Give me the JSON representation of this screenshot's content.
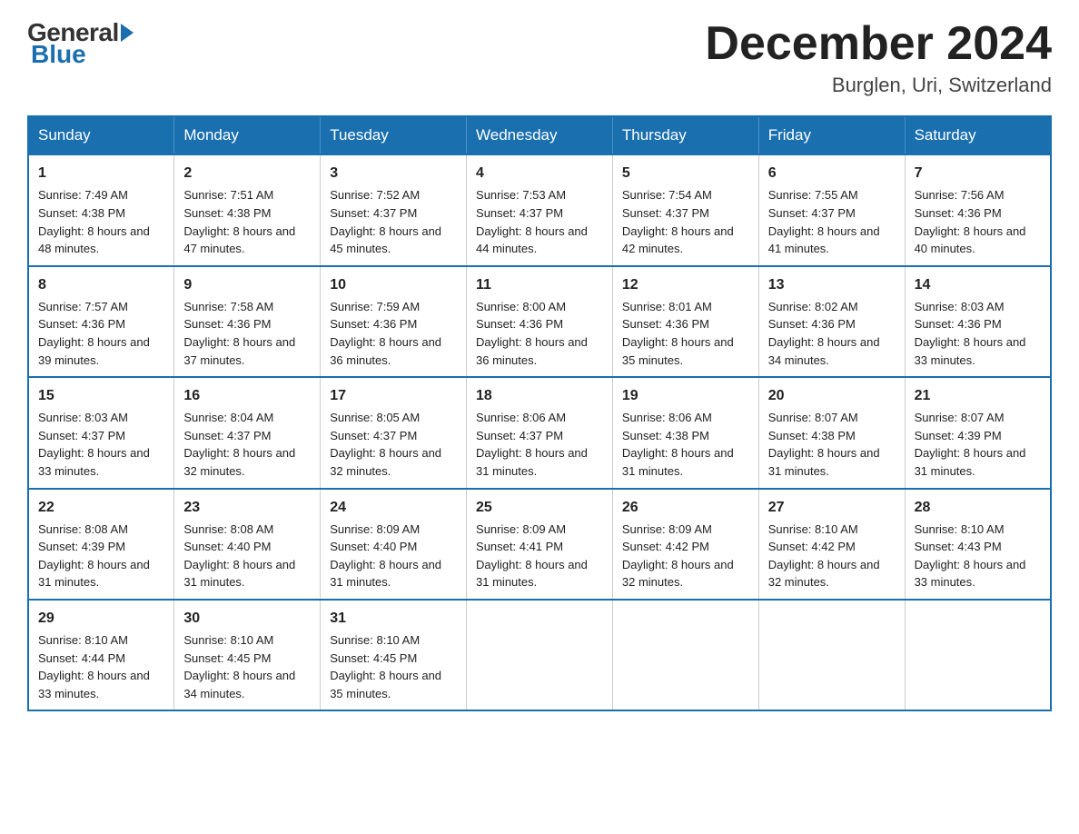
{
  "header": {
    "logo_text_general": "General",
    "logo_text_blue": "Blue",
    "month_title": "December 2024",
    "location": "Burglen, Uri, Switzerland"
  },
  "weekdays": [
    "Sunday",
    "Monday",
    "Tuesday",
    "Wednesday",
    "Thursday",
    "Friday",
    "Saturday"
  ],
  "weeks": [
    [
      {
        "day": "1",
        "sunrise": "7:49 AM",
        "sunset": "4:38 PM",
        "daylight": "8 hours and 48 minutes."
      },
      {
        "day": "2",
        "sunrise": "7:51 AM",
        "sunset": "4:38 PM",
        "daylight": "8 hours and 47 minutes."
      },
      {
        "day": "3",
        "sunrise": "7:52 AM",
        "sunset": "4:37 PM",
        "daylight": "8 hours and 45 minutes."
      },
      {
        "day": "4",
        "sunrise": "7:53 AM",
        "sunset": "4:37 PM",
        "daylight": "8 hours and 44 minutes."
      },
      {
        "day": "5",
        "sunrise": "7:54 AM",
        "sunset": "4:37 PM",
        "daylight": "8 hours and 42 minutes."
      },
      {
        "day": "6",
        "sunrise": "7:55 AM",
        "sunset": "4:37 PM",
        "daylight": "8 hours and 41 minutes."
      },
      {
        "day": "7",
        "sunrise": "7:56 AM",
        "sunset": "4:36 PM",
        "daylight": "8 hours and 40 minutes."
      }
    ],
    [
      {
        "day": "8",
        "sunrise": "7:57 AM",
        "sunset": "4:36 PM",
        "daylight": "8 hours and 39 minutes."
      },
      {
        "day": "9",
        "sunrise": "7:58 AM",
        "sunset": "4:36 PM",
        "daylight": "8 hours and 37 minutes."
      },
      {
        "day": "10",
        "sunrise": "7:59 AM",
        "sunset": "4:36 PM",
        "daylight": "8 hours and 36 minutes."
      },
      {
        "day": "11",
        "sunrise": "8:00 AM",
        "sunset": "4:36 PM",
        "daylight": "8 hours and 36 minutes."
      },
      {
        "day": "12",
        "sunrise": "8:01 AM",
        "sunset": "4:36 PM",
        "daylight": "8 hours and 35 minutes."
      },
      {
        "day": "13",
        "sunrise": "8:02 AM",
        "sunset": "4:36 PM",
        "daylight": "8 hours and 34 minutes."
      },
      {
        "day": "14",
        "sunrise": "8:03 AM",
        "sunset": "4:36 PM",
        "daylight": "8 hours and 33 minutes."
      }
    ],
    [
      {
        "day": "15",
        "sunrise": "8:03 AM",
        "sunset": "4:37 PM",
        "daylight": "8 hours and 33 minutes."
      },
      {
        "day": "16",
        "sunrise": "8:04 AM",
        "sunset": "4:37 PM",
        "daylight": "8 hours and 32 minutes."
      },
      {
        "day": "17",
        "sunrise": "8:05 AM",
        "sunset": "4:37 PM",
        "daylight": "8 hours and 32 minutes."
      },
      {
        "day": "18",
        "sunrise": "8:06 AM",
        "sunset": "4:37 PM",
        "daylight": "8 hours and 31 minutes."
      },
      {
        "day": "19",
        "sunrise": "8:06 AM",
        "sunset": "4:38 PM",
        "daylight": "8 hours and 31 minutes."
      },
      {
        "day": "20",
        "sunrise": "8:07 AM",
        "sunset": "4:38 PM",
        "daylight": "8 hours and 31 minutes."
      },
      {
        "day": "21",
        "sunrise": "8:07 AM",
        "sunset": "4:39 PM",
        "daylight": "8 hours and 31 minutes."
      }
    ],
    [
      {
        "day": "22",
        "sunrise": "8:08 AM",
        "sunset": "4:39 PM",
        "daylight": "8 hours and 31 minutes."
      },
      {
        "day": "23",
        "sunrise": "8:08 AM",
        "sunset": "4:40 PM",
        "daylight": "8 hours and 31 minutes."
      },
      {
        "day": "24",
        "sunrise": "8:09 AM",
        "sunset": "4:40 PM",
        "daylight": "8 hours and 31 minutes."
      },
      {
        "day": "25",
        "sunrise": "8:09 AM",
        "sunset": "4:41 PM",
        "daylight": "8 hours and 31 minutes."
      },
      {
        "day": "26",
        "sunrise": "8:09 AM",
        "sunset": "4:42 PM",
        "daylight": "8 hours and 32 minutes."
      },
      {
        "day": "27",
        "sunrise": "8:10 AM",
        "sunset": "4:42 PM",
        "daylight": "8 hours and 32 minutes."
      },
      {
        "day": "28",
        "sunrise": "8:10 AM",
        "sunset": "4:43 PM",
        "daylight": "8 hours and 33 minutes."
      }
    ],
    [
      {
        "day": "29",
        "sunrise": "8:10 AM",
        "sunset": "4:44 PM",
        "daylight": "8 hours and 33 minutes."
      },
      {
        "day": "30",
        "sunrise": "8:10 AM",
        "sunset": "4:45 PM",
        "daylight": "8 hours and 34 minutes."
      },
      {
        "day": "31",
        "sunrise": "8:10 AM",
        "sunset": "4:45 PM",
        "daylight": "8 hours and 35 minutes."
      },
      null,
      null,
      null,
      null
    ]
  ],
  "labels": {
    "sunrise": "Sunrise:",
    "sunset": "Sunset:",
    "daylight": "Daylight:"
  }
}
